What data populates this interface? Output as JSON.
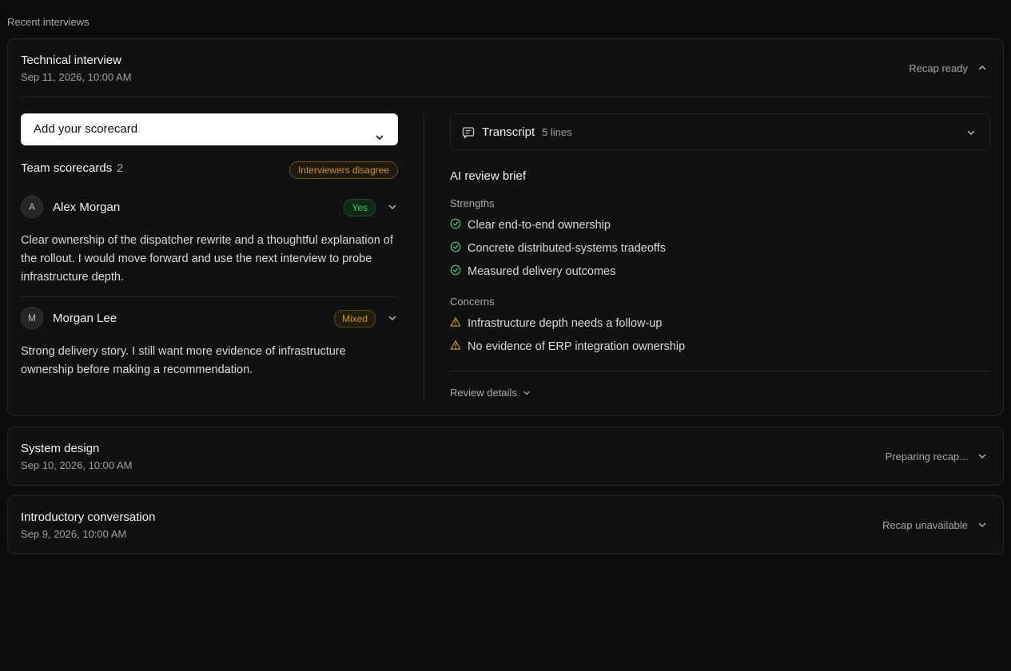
{
  "section_label": "Recent interviews",
  "interviews": [
    {
      "title": "Technical interview",
      "date": "Sep 11, 2026, 10:00 AM",
      "status": "Recap ready",
      "expanded": true
    },
    {
      "title": "System design",
      "date": "Sep 10, 2026, 10:00 AM",
      "status": "Preparing recap...",
      "expanded": false
    },
    {
      "title": "Introductory conversation",
      "date": "Sep 9, 2026, 10:00 AM",
      "status": "Recap unavailable",
      "expanded": false
    }
  ],
  "scorecard_select": {
    "label": "Add your scorecard"
  },
  "team_scorecards": {
    "title": "Team scorecards",
    "count": "2",
    "badge": "Interviewers disagree",
    "reviewers": [
      {
        "initial": "A",
        "name": "Alex Morgan",
        "verdict": "Yes",
        "comment": "Clear ownership of the dispatcher rewrite and a thoughtful explanation of the rollout. I would move forward and use the next interview to probe infrastructure depth."
      },
      {
        "initial": "M",
        "name": "Morgan Lee",
        "verdict": "Mixed",
        "comment": "Strong delivery story. I still want more evidence of infrastructure ownership before making a recommendation."
      }
    ]
  },
  "transcript": {
    "label": "Transcript",
    "count": "5 lines"
  },
  "ai_brief": {
    "title": "AI review brief",
    "strengths_label": "Strengths",
    "strengths": [
      "Clear end-to-end ownership",
      "Concrete distributed-systems tradeoffs",
      "Measured delivery outcomes"
    ],
    "concerns_label": "Concerns",
    "concerns": [
      "Infrastructure depth needs a follow-up",
      "No evidence of ERP integration ownership"
    ],
    "review_details": "Review details"
  },
  "colors": {
    "background": "#0d0d0e",
    "success": "#4cc36e",
    "warning": "#c8962f"
  },
  "icons": {
    "collapse": "chevron-up-icon",
    "expand": "chevron-down-icon",
    "transcript": "transcript-icon",
    "strength": "check-circle-icon",
    "concern": "warning-triangle-icon"
  }
}
